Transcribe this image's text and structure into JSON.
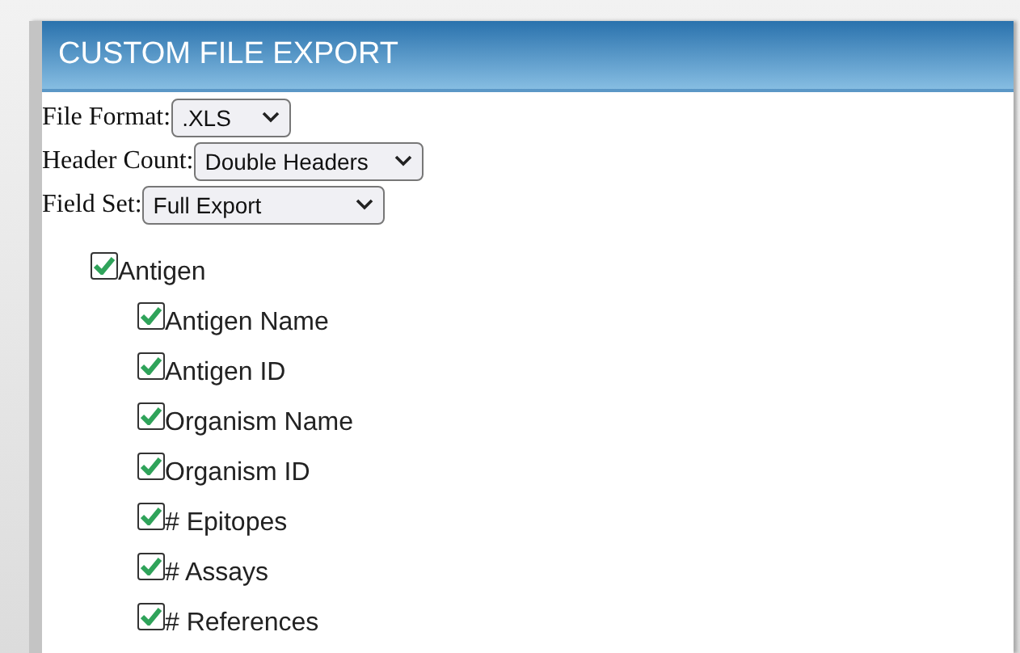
{
  "dialog": {
    "title": "CUSTOM FILE EXPORT"
  },
  "settings": [
    {
      "label": "File Format:",
      "value": ".XLS"
    },
    {
      "label": "Header Count:",
      "value": "Double Headers"
    },
    {
      "label": "Field Set:",
      "value": "Full Export"
    }
  ],
  "fields": [
    {
      "label": "Antigen",
      "checked": true,
      "children": [
        {
          "label": "Antigen Name",
          "checked": true
        },
        {
          "label": "Antigen ID",
          "checked": true
        },
        {
          "label": "Organism Name",
          "checked": true
        },
        {
          "label": "Organism ID",
          "checked": true
        },
        {
          "label": "# Epitopes",
          "checked": true
        },
        {
          "label": "# Assays",
          "checked": true
        },
        {
          "label": "# References",
          "checked": true
        }
      ]
    }
  ]
}
